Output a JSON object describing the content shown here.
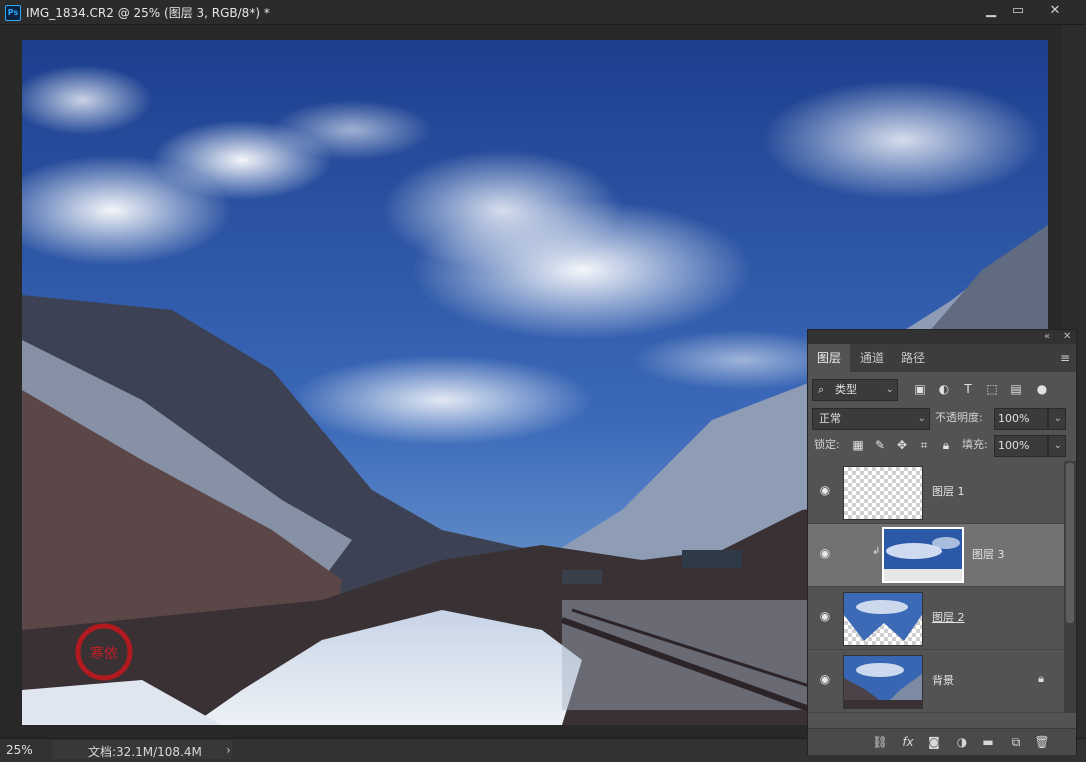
{
  "window": {
    "title": "IMG_1834.CR2 @ 25% (图层 3, RGB/8*) *",
    "app_icon": "Ps",
    "minimize": "▁",
    "restore": "▭",
    "close": "✕"
  },
  "status": {
    "zoom": "25%",
    "doc_info": "文档:32.1M/108.4M",
    "arrow": "›"
  },
  "photo": {
    "watermark_text": "寒依"
  },
  "layers_panel": {
    "collapse": "«",
    "close": "✕",
    "tabs": [
      "图层",
      "通道",
      "路径"
    ],
    "active_tab": "图层",
    "menu_icon": "≡",
    "filter_kind": "类型",
    "blend_mode": "正常",
    "opacity_label": "不透明度:",
    "opacity_value": "100%",
    "lock_label": "锁定:",
    "fill_label": "填充:",
    "fill_value": "100%",
    "layers": [
      {
        "name": "图层 1",
        "visible": true,
        "selected": false,
        "thumb": "transparent"
      },
      {
        "name": "图层 3",
        "visible": true,
        "selected": true,
        "thumb": "sky",
        "clipped": true
      },
      {
        "name": "图层 2",
        "visible": true,
        "selected": false,
        "thumb": "sky-mask"
      },
      {
        "name": "背景",
        "visible": true,
        "selected": false,
        "thumb": "photo",
        "locked": true
      }
    ],
    "bottom_icons": [
      "link-icon",
      "fx-icon",
      "mask-icon",
      "adjustment-icon",
      "folder-icon",
      "new-layer-icon",
      "trash-icon"
    ]
  },
  "colors": {
    "annotation_arrow": "#e8463a",
    "panel_bg": "#535353",
    "selected_layer": "#727272"
  }
}
